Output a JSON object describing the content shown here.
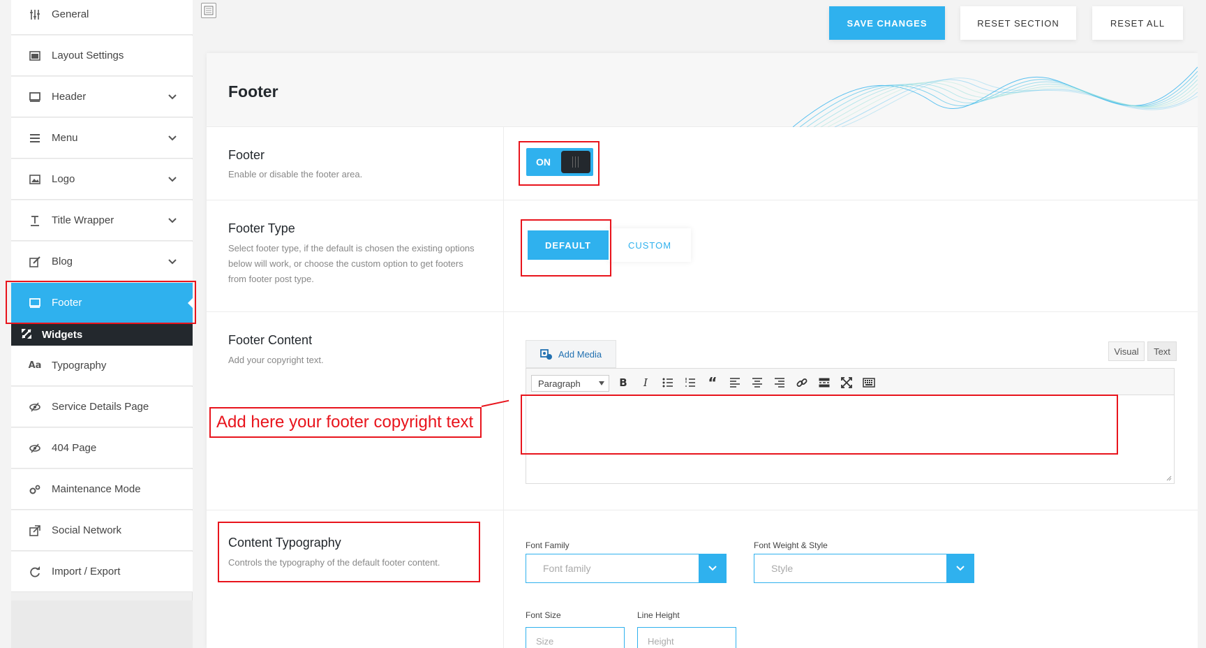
{
  "sidebar": {
    "items": [
      {
        "label": "General",
        "icon": "sliders-icon",
        "has_chevron": false
      },
      {
        "label": "Layout Settings",
        "icon": "layout-icon",
        "has_chevron": false
      },
      {
        "label": "Header",
        "icon": "monitor-icon",
        "has_chevron": true
      },
      {
        "label": "Menu",
        "icon": "menu-icon",
        "has_chevron": true
      },
      {
        "label": "Logo",
        "icon": "image-icon",
        "has_chevron": true
      },
      {
        "label": "Title Wrapper",
        "icon": "text-icon",
        "has_chevron": true
      },
      {
        "label": "Blog",
        "icon": "edit-icon",
        "has_chevron": true
      },
      {
        "label": "Footer",
        "icon": "monitor-icon",
        "has_chevron": false,
        "active": true
      }
    ],
    "widgets_label": "Widgets",
    "items_after": [
      {
        "label": "Typography",
        "icon": "typography-icon",
        "glyph": "Aa"
      },
      {
        "label": "Service Details Page",
        "icon": "eye-slash-icon"
      },
      {
        "label": "404 Page",
        "icon": "eye-slash-icon"
      },
      {
        "label": "Maintenance Mode",
        "icon": "cogs-icon"
      },
      {
        "label": "Social Network",
        "icon": "share-icon"
      },
      {
        "label": "Import / Export",
        "icon": "refresh-icon"
      }
    ]
  },
  "toolbar": {
    "save_label": "SAVE CHANGES",
    "reset_section_label": "RESET SECTION",
    "reset_all_label": "RESET ALL"
  },
  "section": {
    "title": "Footer"
  },
  "footer_toggle": {
    "title": "Footer",
    "desc": "Enable or disable the footer area.",
    "state_label": "ON"
  },
  "footer_type": {
    "title": "Footer Type",
    "desc": "Select footer type, if the default is chosen the existing options below will work, or choose the custom option to get footers from footer post type.",
    "options": [
      "DEFAULT",
      "CUSTOM"
    ],
    "selected": "DEFAULT"
  },
  "footer_content": {
    "title": "Footer Content",
    "desc": "Add your copyright text.",
    "add_media_label": "Add Media",
    "tab_visual": "Visual",
    "tab_text": "Text",
    "format_select": "Paragraph",
    "annotation": "Add here your footer copyright text"
  },
  "content_typography": {
    "title": "Content Typography",
    "desc": "Controls the typography of the default footer content.",
    "font_family_label": "Font Family",
    "font_family_placeholder": "Font family",
    "font_weight_label": "Font Weight & Style",
    "font_weight_placeholder": "Style",
    "font_size_label": "Font Size",
    "font_size_placeholder": "Size",
    "line_height_label": "Line Height",
    "line_height_placeholder": "Height"
  },
  "colors": {
    "accent": "#2fb1ee",
    "dark": "#23282d",
    "annotation_red": "#e8141c"
  }
}
